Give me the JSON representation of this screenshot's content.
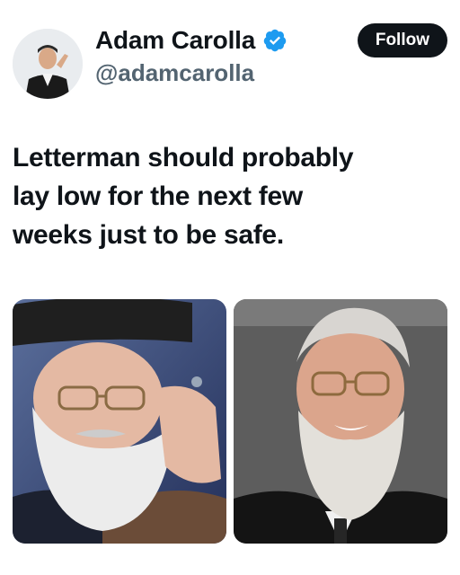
{
  "author": {
    "display_name": "Adam Carolla",
    "handle": "@adamcarolla",
    "verified_icon": "verified-badge-icon",
    "follow_label": "Follow",
    "colors": {
      "verified": "#1d9bf0",
      "follow_bg": "#0f1419",
      "handle": "#536471"
    }
  },
  "tweet": {
    "text": "Letterman should probably\nlay low for the next few\nweeks just to be safe."
  },
  "media": {
    "images": [
      {
        "name": "photo-man-black-turban-glasses-white-beard"
      },
      {
        "name": "photo-man-glasses-white-beard-suit"
      }
    ]
  }
}
